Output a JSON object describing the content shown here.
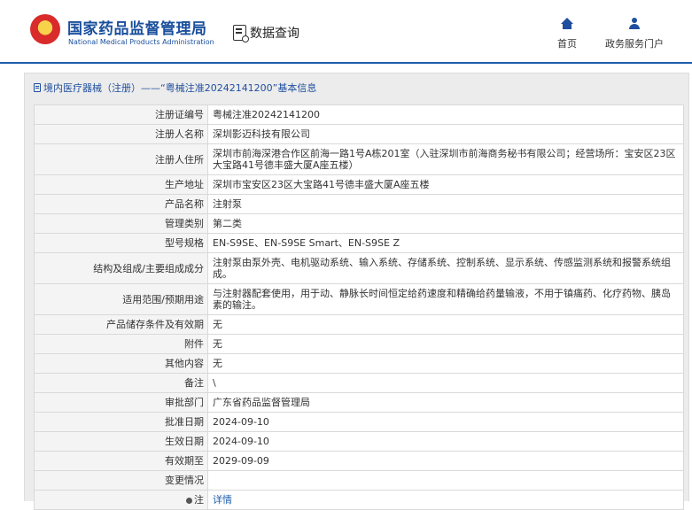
{
  "header": {
    "brand_cn": "国家药品监督管理局",
    "brand_en": "National Medical Products Administration",
    "data_query": "数据查询",
    "nav": [
      {
        "label": "首页",
        "icon": "home-icon"
      },
      {
        "label": "政务服务门户",
        "icon": "user-icon"
      }
    ]
  },
  "breadcrumb": "境内医疗器械（注册）——“粤械注准20242141200”基本信息",
  "rows": [
    {
      "label": "注册证编号",
      "value": "粤械注准20242141200"
    },
    {
      "label": "注册人名称",
      "value": "深圳影迈科技有限公司"
    },
    {
      "label": "注册人住所",
      "value": "深圳市前海深港合作区前海一路1号A栋201室（入驻深圳市前海商务秘书有限公司；经营场所：宝安区23区大宝路41号德丰盛大厦A座五楼）"
    },
    {
      "label": "生产地址",
      "value": "深圳市宝安区23区大宝路41号德丰盛大厦A座五楼"
    },
    {
      "label": "产品名称",
      "value": "注射泵"
    },
    {
      "label": "管理类别",
      "value": "第二类"
    },
    {
      "label": "型号规格",
      "value": "EN-S9SE、EN-S9SE Smart、EN-S9SE Z"
    },
    {
      "label": "结构及组成/主要组成成分",
      "value": "注射泵由泵外壳、电机驱动系统、输入系统、存储系统、控制系统、显示系统、传感监测系统和报警系统组成。"
    },
    {
      "label": "适用范围/预期用途",
      "value": "与注射器配套使用，用于动、静脉长时间恒定给药速度和精确给药量输液，不用于镇痛药、化疗药物、胰岛素的输注。"
    },
    {
      "label": "产品储存条件及有效期",
      "value": "无"
    },
    {
      "label": "附件",
      "value": "无"
    },
    {
      "label": "其他内容",
      "value": "无"
    },
    {
      "label": "备注",
      "value": "\\"
    },
    {
      "label": "审批部门",
      "value": "广东省药品监督管理局"
    },
    {
      "label": "批准日期",
      "value": "2024-09-10"
    },
    {
      "label": "生效日期",
      "value": "2024-09-10"
    },
    {
      "label": "有效期至",
      "value": "2029-09-09"
    },
    {
      "label": "变更情况",
      "value": ""
    }
  ],
  "note_row": {
    "label": "注",
    "value": "详情"
  }
}
